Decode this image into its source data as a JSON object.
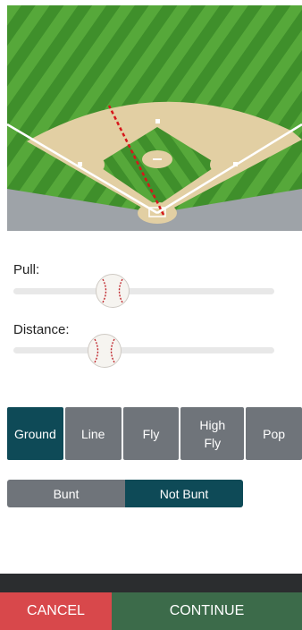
{
  "field": {
    "diagram": "baseball-field-hit-direction"
  },
  "pull": {
    "label": "Pull:",
    "value_fraction": 0.38
  },
  "distance": {
    "label": "Distance:",
    "value_fraction": 0.35
  },
  "hit_types": [
    {
      "label": "Ground",
      "selected": true
    },
    {
      "label": "Line",
      "selected": false
    },
    {
      "label": "Fly",
      "selected": false
    },
    {
      "label": "High Fly",
      "selected": false
    },
    {
      "label": "Pop",
      "selected": false
    }
  ],
  "bunt": [
    {
      "label": "Bunt",
      "selected": false
    },
    {
      "label": "Not Bunt",
      "selected": true
    }
  ],
  "footer": {
    "cancel": "CANCEL",
    "continue": "CONTINUE"
  },
  "colors": {
    "selected": "#0e4a57",
    "unselected": "#6f747a",
    "cancel": "#d8484b",
    "continue": "#3c6b4a",
    "grass": "#4a9a33",
    "dirt": "#e2cfa3"
  }
}
